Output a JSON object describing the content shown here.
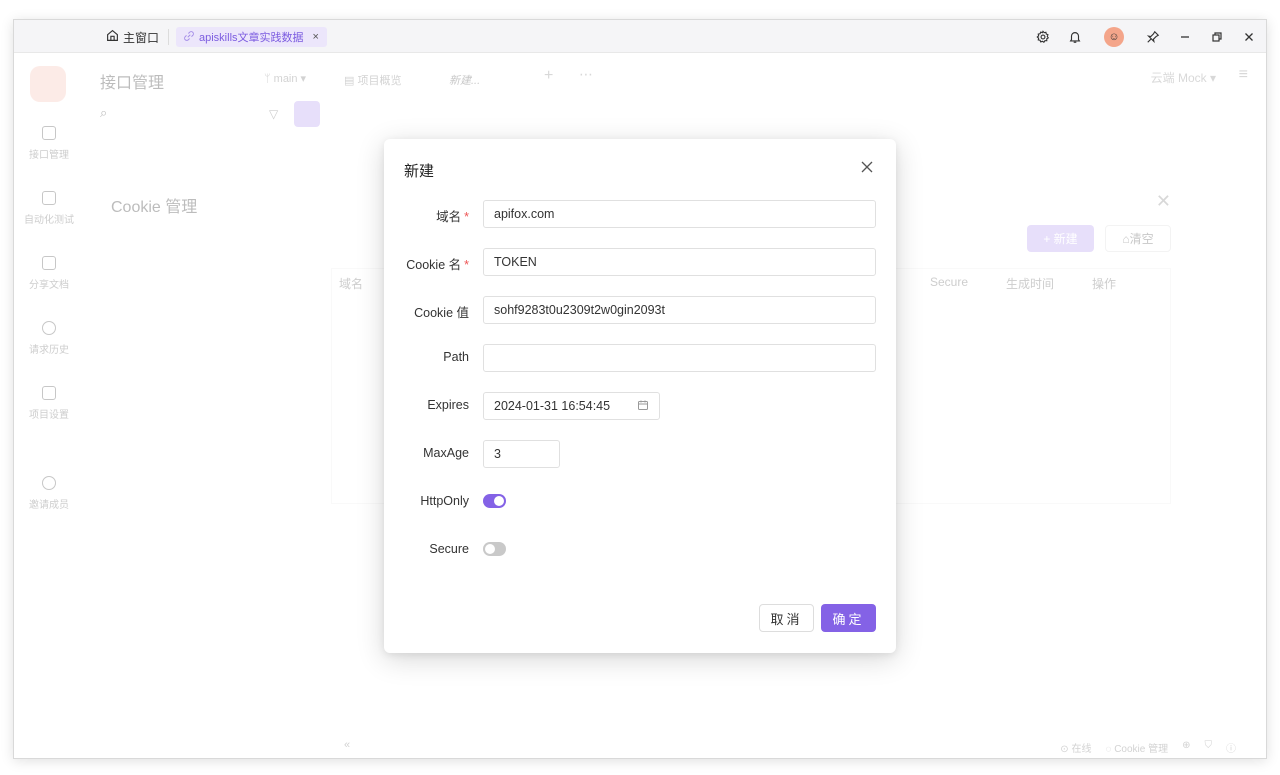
{
  "titlebar": {
    "home_tab": "主窗口",
    "active_tab": "apiskills文章实践数据",
    "active_tab_close": "×"
  },
  "app": {
    "header_title": "接口管理",
    "branch": "main",
    "project_tab": "项目概览",
    "new_tab": "新建...",
    "cloud_mock": "云端 Mock",
    "sidebar": [
      {
        "label": "接口管理"
      },
      {
        "label": "自动化测试"
      },
      {
        "label": "分享文档"
      },
      {
        "label": "请求历史"
      },
      {
        "label": "项目设置"
      },
      {
        "label": "邀请成员"
      }
    ]
  },
  "cookie_manager": {
    "title": "Cookie 管理",
    "new_button": "+ 新建",
    "clear_button": "清空",
    "columns": {
      "domain": "域名",
      "secure": "Secure",
      "created": "生成时间",
      "actions": "操作"
    }
  },
  "statusbar": {
    "online": "在线",
    "cookie_manage": "Cookie 管理"
  },
  "modal": {
    "title": "新建",
    "domain_label": "域名",
    "domain_value": "apifox.com",
    "cookie_name_label": "Cookie 名",
    "cookie_name_value": "TOKEN",
    "cookie_value_label": "Cookie 值",
    "cookie_value_value": "sohf9283t0u2309t2w0gin2093t",
    "path_label": "Path",
    "path_value": "",
    "expires_label": "Expires",
    "expires_value": "2024-01-31 16:54:45",
    "maxage_label": "MaxAge",
    "maxage_value": "3",
    "httponly_label": "HttpOnly",
    "httponly_on": true,
    "secure_label": "Secure",
    "secure_on": false,
    "required_mark": "*",
    "cancel_label": "取消",
    "ok_label": "确定"
  },
  "colors": {
    "accent": "#8462e6",
    "accent_light": "#ece6fb",
    "required": "#e55555"
  }
}
